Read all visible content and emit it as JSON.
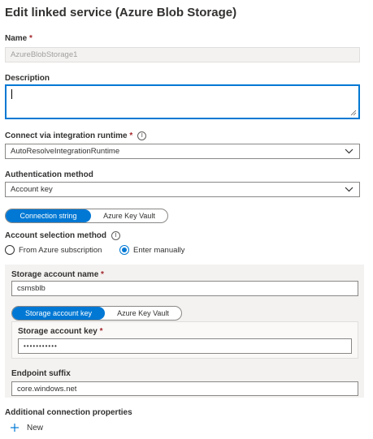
{
  "title": "Edit linked service (Azure Blob Storage)",
  "name": {
    "label": "Name",
    "required_mark": "*",
    "value": "AzureBlobStorage1"
  },
  "description": {
    "label": "Description",
    "value": ""
  },
  "runtime": {
    "label": "Connect via integration runtime",
    "required_mark": "*",
    "value": "AutoResolveIntegrationRuntime"
  },
  "auth": {
    "label": "Authentication method",
    "value": "Account key"
  },
  "connection_toggle": {
    "options": [
      "Connection string",
      "Azure Key Vault"
    ],
    "selected": "Connection string"
  },
  "account_selection": {
    "label": "Account selection method",
    "options": [
      "From Azure subscription",
      "Enter manually"
    ],
    "selected": "Enter manually"
  },
  "storage_name": {
    "label": "Storage account name",
    "required_mark": "*",
    "value": "csmsblb"
  },
  "key_toggle": {
    "options": [
      "Storage account key",
      "Azure Key Vault"
    ],
    "selected": "Storage account key"
  },
  "storage_key": {
    "label": "Storage account key",
    "required_mark": "*",
    "value": "•••••••••••"
  },
  "endpoint": {
    "label": "Endpoint suffix",
    "value": "core.windows.net"
  },
  "additional": {
    "label": "Additional connection properties",
    "new_label": "New"
  },
  "colors": {
    "accent": "#0078d4",
    "required": "#a4262c",
    "panel": "#f3f2f1"
  }
}
